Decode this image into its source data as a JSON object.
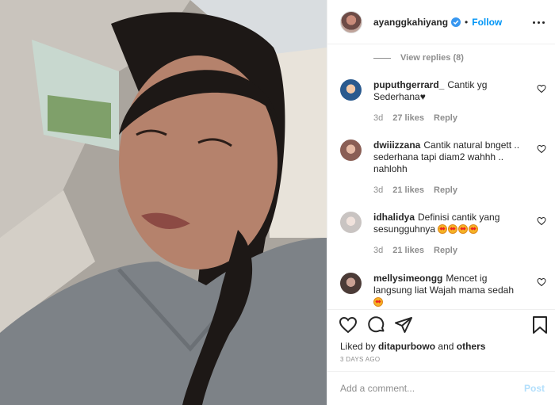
{
  "post": {
    "username": "ayanggkahiyang",
    "verified": true,
    "separator": "•",
    "follow_label": "Follow",
    "more_icon": "more-options-icon"
  },
  "replies": {
    "label": "View replies (8)"
  },
  "comments": [
    {
      "username": "puputhgerrard_",
      "text": "Cantik yg Sederhana",
      "suffix": "♥",
      "time": "3d",
      "likes": "27 likes",
      "reply": "Reply",
      "avatar_color": "#2a5a8e"
    },
    {
      "username": "dwiiizzana",
      "text": "Cantik natural bngett .. sederhana tapi diam2 wahhh .. nahlohh",
      "time": "3d",
      "likes": "21 likes",
      "reply": "Reply",
      "avatar_color": "#b07a6b"
    },
    {
      "username": "idhalidya",
      "text": "Definisi cantik yang sesungguhnya",
      "emoji_count": 4,
      "time": "3d",
      "likes": "21 likes",
      "reply": "Reply",
      "avatar_color": "#d9d6d4"
    },
    {
      "username": "mellysimeongg",
      "text": "Mencet ig langsung liat Wajah mama sedah",
      "emoji_count": 1,
      "avatar_color": "#6b5a55"
    }
  ],
  "actions": {
    "liked_prefix": "Liked by",
    "liked_user": "ditapurbowo",
    "liked_and": "and",
    "liked_others": "others",
    "date": "3 DAYS AGO"
  },
  "add_comment": {
    "placeholder": "Add a comment...",
    "post_label": "Post"
  },
  "colors": {
    "accent": "#0095f6",
    "muted": "#8e8e8e",
    "text": "#262626",
    "post_disabled": "#b2dffc"
  }
}
